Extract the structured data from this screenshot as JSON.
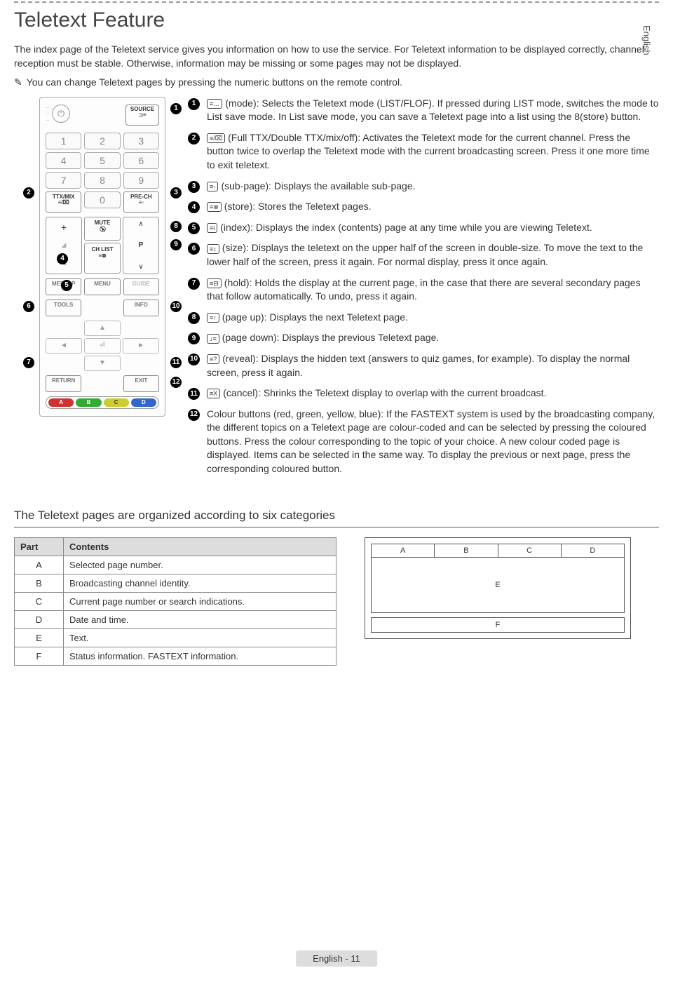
{
  "lang_tab": "English",
  "title": "Teletext Feature",
  "intro": "The index page of the Teletext service gives you information on how to use the service. For Teletext information to be displayed correctly, channel reception must be stable. Otherwise, information may be missing or some pages may not be displayed.",
  "note_icon": "✎",
  "note": "You can change Teletext pages by pressing the numeric buttons on the remote control.",
  "remote": {
    "source": "SOURCE",
    "nums": [
      "1",
      "2",
      "3",
      "4",
      "5",
      "6",
      "7",
      "8",
      "9"
    ],
    "ttxmix": "TTX/MIX",
    "zero": "0",
    "prech": "PRE-CH",
    "mute": "MUTE",
    "chlist": "CH LIST",
    "plus": "+",
    "minus": "−",
    "p_label": "P",
    "up": "∧",
    "down": "∨",
    "mediap": "MEDIA.P",
    "menu": "MENU",
    "guide": "GUIDE",
    "tools": "TOOLS",
    "info": "INFO",
    "return": "RETURN",
    "exit": "EXIT",
    "left": "◄",
    "right": "►",
    "aup": "▲",
    "adown": "▼",
    "center": "⏎",
    "color": {
      "a": "A",
      "b": "B",
      "c": "C",
      "d": "D"
    }
  },
  "callouts_inline": {
    "1": "1",
    "2": "2",
    "3": "3",
    "4": "4",
    "5": "5",
    "6": "6",
    "7": "7",
    "8": "8",
    "9": "9",
    "10": "10",
    "11": "11",
    "12": "12"
  },
  "descriptions": [
    {
      "n": "1",
      "icon": "≡…",
      "text": "(mode): Selects the Teletext mode (LIST/FLOF). If pressed during LIST mode, switches the mode to List save mode. In List save mode, you can save a Teletext page into a list using the 8(store) button."
    },
    {
      "n": "2",
      "icon": "≡/⌧",
      "text": "(Full TTX/Double TTX/mix/off): Activates the Teletext mode for the current channel. Press the button twice to overlap the Teletext mode with the current broadcasting screen. Press it one more time to exit teletext."
    },
    {
      "n": "3",
      "icon": "≡◦",
      "text": "(sub-page): Displays the available sub-page."
    },
    {
      "n": "4",
      "icon": "≡⊗",
      "text": "(store): Stores the Teletext pages."
    },
    {
      "n": "5",
      "icon": "≡i",
      "text": "(index): Displays the index (contents) page at any time while you are viewing Teletext."
    },
    {
      "n": "6",
      "icon": "≡↕",
      "text": "(size): Displays the teletext on the upper half of the screen in double-size. To move the text to the lower half of the screen, press it again. For normal display, press it once again."
    },
    {
      "n": "7",
      "icon": "≡⊟",
      "text": "(hold): Holds the display at the current page, in the case that there are several secondary pages that follow automatically. To undo, press it again."
    },
    {
      "n": "8",
      "icon": "≡↑",
      "text": "(page up): Displays the next Teletext page."
    },
    {
      "n": "9",
      "icon": "↓≡",
      "text": "(page down): Displays the previous Teletext page."
    },
    {
      "n": "10",
      "icon": "≡?",
      "text": "(reveal): Displays the hidden text (answers to quiz games, for example). To display the normal screen, press it again."
    },
    {
      "n": "11",
      "icon": "≡X",
      "text": "(cancel): Shrinks the Teletext display to overlap with the current broadcast."
    },
    {
      "n": "12",
      "icon": "",
      "text": "Colour buttons (red, green, yellow, blue): If the FASTEXT system is used by the broadcasting company, the different topics on a Teletext page are colour-coded and can be selected by pressing the coloured buttons. Press the colour corresponding to the topic of your choice. A new colour coded page is displayed. Items can be selected in the same way. To display the previous or next page, press the corresponding coloured button."
    }
  ],
  "section_heading": "The Teletext pages are organized according to six categories",
  "cat_table": {
    "headers": {
      "part": "Part",
      "contents": "Contents"
    },
    "rows": [
      {
        "p": "A",
        "c": "Selected page number."
      },
      {
        "p": "B",
        "c": "Broadcasting channel identity."
      },
      {
        "p": "C",
        "c": "Current page number or search indications."
      },
      {
        "p": "D",
        "c": "Date and time."
      },
      {
        "p": "E",
        "c": "Text."
      },
      {
        "p": "F",
        "c": "Status information. FASTEXT information."
      }
    ]
  },
  "layout_labels": {
    "a": "A",
    "b": "B",
    "c": "C",
    "d": "D",
    "e": "E",
    "f": "F"
  },
  "footer": "English - 11"
}
